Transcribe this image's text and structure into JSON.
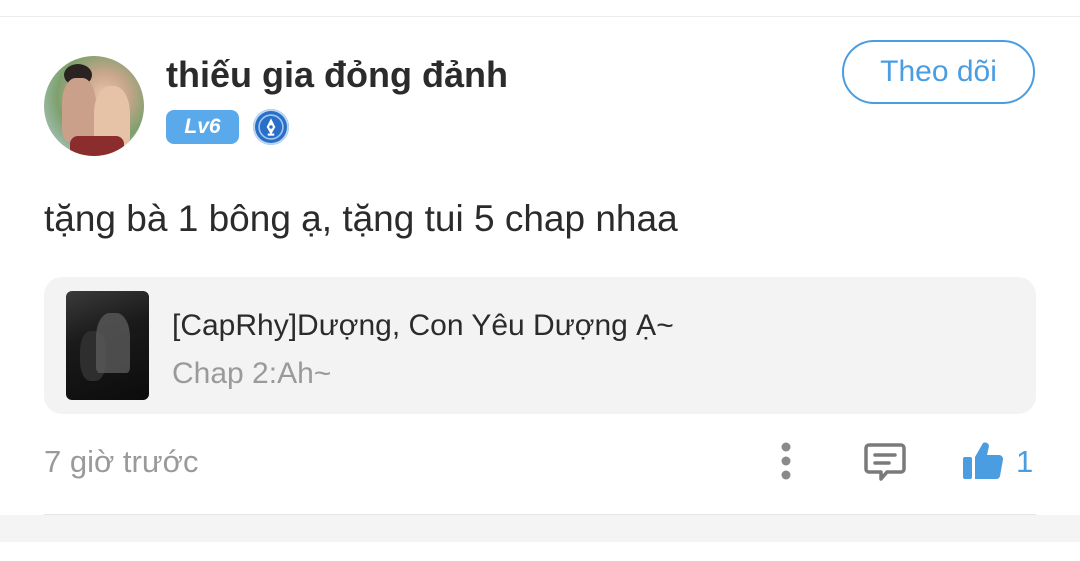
{
  "comment": {
    "author": {
      "name": "thiếu gia đỏng đảnh",
      "level": "Lv6",
      "badge_icon": "pen-nib-icon"
    },
    "follow_label": "Theo dõi",
    "text": "tặng bà 1 bông ạ, tặng tui 5 chap nhaa",
    "story": {
      "title": "[CapRhy]Dượng, Con Yêu Dượng Ạ~",
      "chapter": "Chap 2:Ah~"
    },
    "timestamp": "7 giờ trước",
    "like_count": "1",
    "icons": {
      "more": "more-vertical-icon",
      "reply": "comment-icon",
      "like": "thumbs-up-icon"
    }
  },
  "colors": {
    "accent": "#4a9de0",
    "level_badge": "#5aa9eb",
    "pen_badge": "#2a6fc7",
    "card_bg": "#f3f3f3",
    "muted_text": "#9a9a9a"
  }
}
